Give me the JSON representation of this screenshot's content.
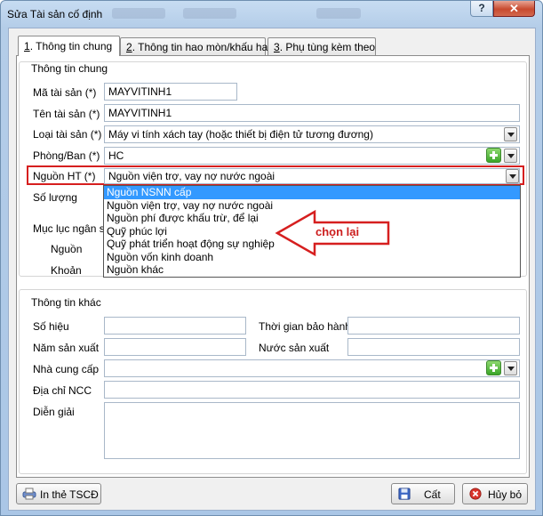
{
  "window": {
    "title": "Sửa Tài sản cố định",
    "help_label": "?",
    "close_label": "✕"
  },
  "tabs": [
    {
      "num": "1",
      "label": ". Thông tin chung"
    },
    {
      "num": "2",
      "label": ". Thông tin hao mòn/khấu hao"
    },
    {
      "num": "3",
      "label": ". Phụ tùng kèm theo"
    }
  ],
  "general": {
    "group_title": "Thông tin chung",
    "asset_code_label": "Mã tài sản (*)",
    "asset_code_value": "MAYVITINH1",
    "asset_name_label": "Tên tài sản (*)",
    "asset_name_value": "MAYVITINH1",
    "asset_type_label": "Loại tài sản (*)",
    "asset_type_value": "Máy vi tính xách tay (hoặc thiết bị điện tử tương đương)",
    "department_label": "Phòng/Ban (*)",
    "department_value": "HC",
    "source_label": "Nguồn HT (*)",
    "source_value": "Nguồn viện trợ, vay nợ nước ngoài",
    "quantity_label": "Số lượng",
    "budget_label": "Mục lục ngân sách",
    "budget_source_label": "Nguồn",
    "budget_item_label": "Khoản"
  },
  "source_dropdown": {
    "options": [
      "Nguồn NSNN cấp",
      "Nguồn viện trợ, vay nợ nước ngoài",
      "Nguồn phí được khấu trừ, để lại",
      "Quỹ phúc lợi",
      "Quỹ phát triển hoạt động sự nghiệp",
      "Nguồn vốn kinh doanh",
      "Nguồn khác"
    ],
    "selected_index": 0
  },
  "annotation": {
    "text": "chọn lại",
    "color": "#d61f1f"
  },
  "other": {
    "group_title": "Thông tin khác",
    "serial_label": "Số hiệu",
    "warranty_label": "Thời gian bảo hành",
    "year_label": "Năm sản xuất",
    "country_label": "Nước sản xuất",
    "supplier_label": "Nhà cung cấp",
    "supplier_address_label": "Địa chỉ NCC",
    "description_label": "Diễn giải"
  },
  "buttons": {
    "print_label": "In thẻ TSCĐ",
    "save_label": "Cất",
    "cancel_label": "Hủy bỏ"
  },
  "colors": {
    "accent": "#3399ff",
    "highlight": "#d61f1f"
  }
}
